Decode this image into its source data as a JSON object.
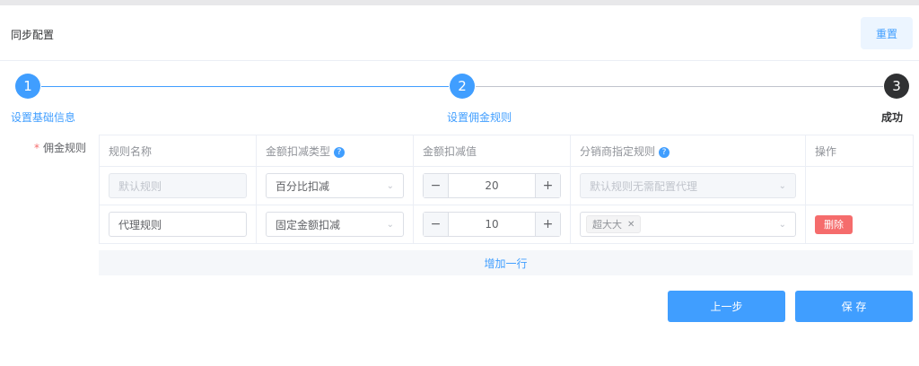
{
  "header": {
    "title": "同步配置",
    "reset_label": "重置"
  },
  "steps": [
    {
      "number": "1",
      "title": "设置基础信息",
      "status": "done"
    },
    {
      "number": "2",
      "title": "设置佣金规则",
      "status": "current"
    },
    {
      "number": "3",
      "title": "成功",
      "status": "wait"
    }
  ],
  "form": {
    "required_mark": "*",
    "label": "佣金规则",
    "columns": [
      "规则名称",
      "金额扣减类型",
      "金额扣减值",
      "分销商指定规则",
      "操作"
    ],
    "help_icon": "?",
    "rows": [
      {
        "name_placeholder": "默认规则",
        "deduct_type": "百分比扣减",
        "value": "20",
        "distributor_placeholder": "默认规则无需配置代理"
      },
      {
        "name": "代理规则",
        "deduct_type": "固定金额扣减",
        "value": "10",
        "distributor_tag": "超大大",
        "delete_label": "删除"
      }
    ],
    "add_row_label": "增加一行"
  },
  "footer": {
    "prev_label": "上一步",
    "save_label": "保 存"
  },
  "colors": {
    "primary": "#409eff",
    "success_step": "#303133",
    "danger": "#f56c6c"
  }
}
